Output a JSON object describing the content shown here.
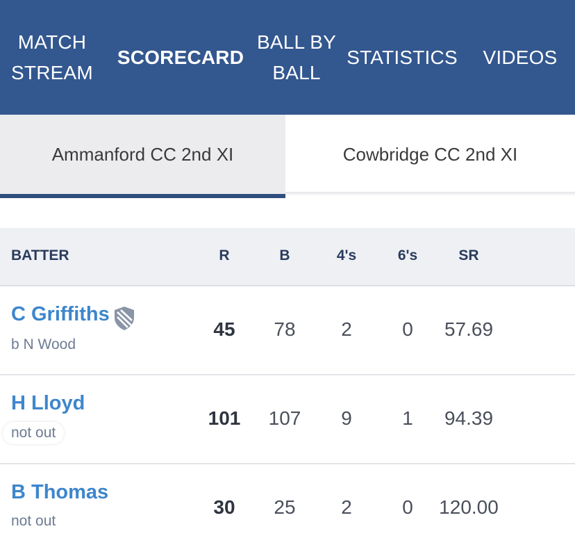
{
  "nav": {
    "items": [
      {
        "label": "MATCH\nSTREAM",
        "active": false
      },
      {
        "label": "SCORECARD",
        "active": true
      },
      {
        "label": "BALL BY\nBALL",
        "active": false
      },
      {
        "label": "STATISTICS",
        "active": false
      },
      {
        "label": "VIDEOS",
        "active": false
      }
    ]
  },
  "teams": {
    "home": "Ammanford CC 2nd XI",
    "away": "Cowbridge CC 2nd XI",
    "selected": "home"
  },
  "table": {
    "headers": {
      "batter": "BATTER",
      "runs": "R",
      "balls": "B",
      "fours": "4's",
      "sixes": "6's",
      "strike_rate": "SR"
    },
    "rows": [
      {
        "name": "C Griffiths",
        "dismissal": "b N Wood",
        "captain": true,
        "runs": "45",
        "balls": "78",
        "fours": "2",
        "sixes": "0",
        "sr": "57.69"
      },
      {
        "name": "H Lloyd",
        "dismissal": "not out",
        "captain": false,
        "runs": "101",
        "balls": "107",
        "fours": "9",
        "sixes": "1",
        "sr": "94.39"
      },
      {
        "name": "B Thomas",
        "dismissal": "not out",
        "captain": false,
        "runs": "30",
        "balls": "25",
        "fours": "2",
        "sixes": "0",
        "sr": "120.00"
      }
    ]
  },
  "colors": {
    "nav_bg": "#33578f",
    "name_link": "#3d86cc",
    "tab_underline": "#2f4f7e"
  },
  "icons": {
    "captain": "shield-icon"
  }
}
